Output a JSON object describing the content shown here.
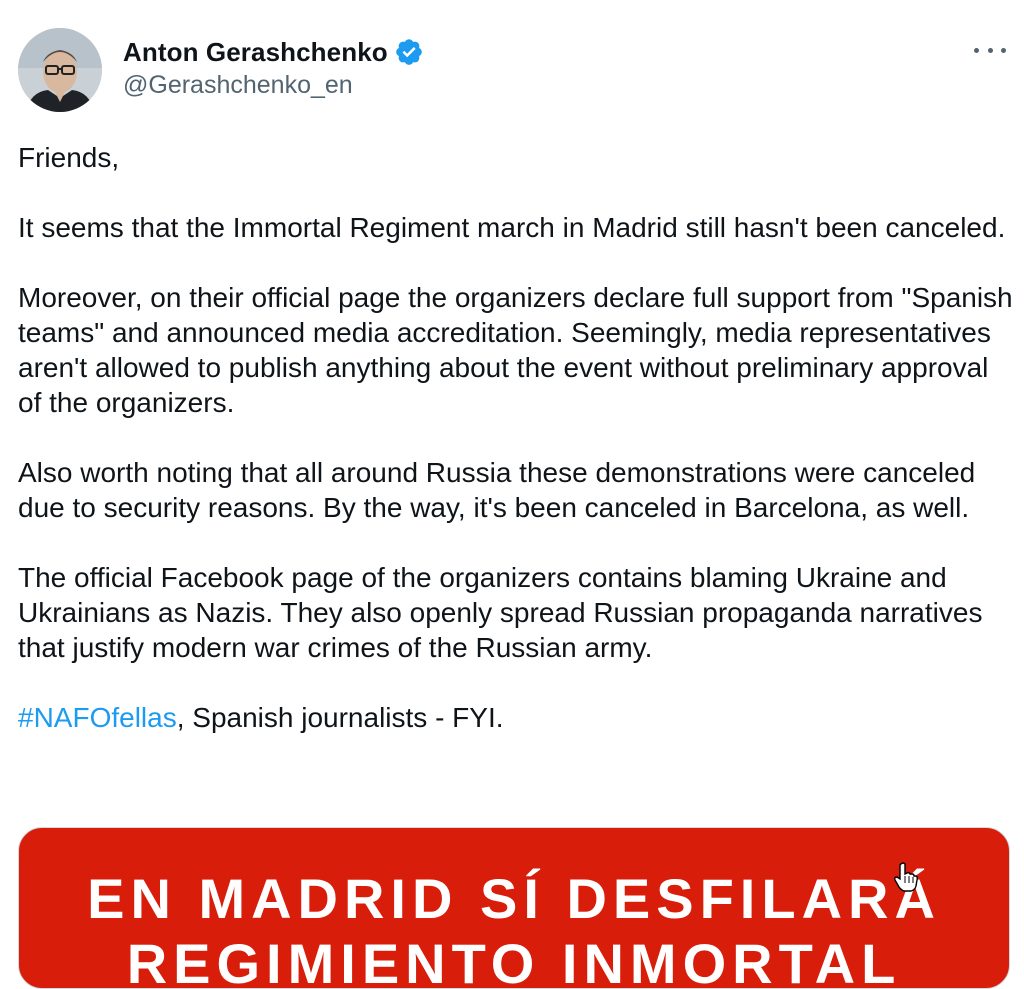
{
  "author": {
    "name": "Anton Gerashchenko",
    "handle": "@Gerashchenko_en",
    "verified": true
  },
  "icons": {
    "avatar": "profile-photo",
    "verified": "verified-badge-icon",
    "more": "more-options-icon",
    "cursor": "hand-cursor-icon"
  },
  "tweet": {
    "p1": "Friends,",
    "p2": "It seems that the Immortal Regiment march in Madrid still hasn't been canceled.",
    "p3": "Moreover, on their official page the organizers declare full support from \"Spanish teams\" and announced media accreditation. Seemingly, media representatives aren't allowed to publish anything about the event without preliminary approval of the organizers.",
    "p4": "Also worth noting that all around Russia these demonstrations were canceled due to security reasons. By the way, it's been canceled in Barcelona, as well.",
    "p5": "The official Facebook page of the organizers contains blaming Ukraine and Ukrainians as Nazis. They also openly spread Russian propaganda narratives that justify modern war crimes of the Russian army.",
    "hashtag": "#NAFOfellas",
    "p6_rest": ", Spanish journalists - FYI."
  },
  "media": {
    "line1": "EN MADRID SÍ DESFILARÁ",
    "line2": "REGIMIENTO INMORTAL"
  },
  "colors": {
    "link": "#1d9bf0",
    "handle": "#536471",
    "media_background": "#d81e0b",
    "verified": "#1d9bf0"
  }
}
